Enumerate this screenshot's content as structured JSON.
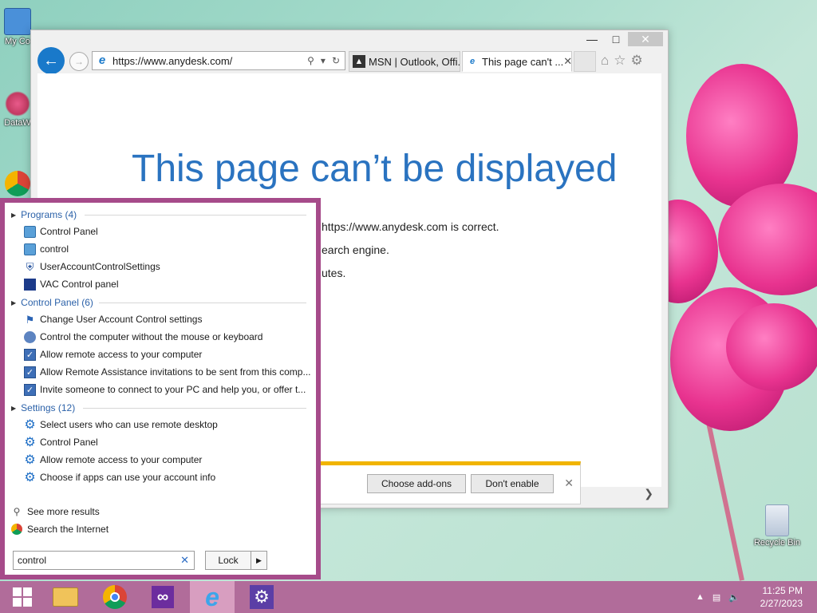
{
  "desktop": {
    "icons": [
      {
        "label": "My Co"
      },
      {
        "label": "DataW"
      },
      {
        "label": ""
      },
      {
        "label": "Recycle Bin"
      }
    ]
  },
  "browser": {
    "address": "https://www.anydesk.com/",
    "tabs": [
      {
        "label": "MSN | Outlook, Offi..."
      },
      {
        "label": "This page can't ..."
      }
    ],
    "error": {
      "title": "This page can’t be displayed",
      "lines": [
        "https://www.anydesk.com is correct.",
        "earch engine.",
        "utes."
      ]
    },
    "notification": {
      "choose_label": "Choose add-ons",
      "dont_label": "Don't enable"
    }
  },
  "search": {
    "sections": [
      {
        "title": "Programs (4)",
        "items": [
          {
            "label": "Control Panel",
            "icon": "control-panel-icon"
          },
          {
            "label": "control",
            "icon": "control-panel-icon"
          },
          {
            "label": "UserAccountControlSettings",
            "icon": "shield-icon"
          },
          {
            "label": "VAC Control panel",
            "icon": "vac-icon"
          }
        ]
      },
      {
        "title": "Control Panel (6)",
        "items": [
          {
            "label": "Change User Account Control settings",
            "icon": "flag-icon"
          },
          {
            "label": "Control the computer without the mouse or keyboard",
            "icon": "ease-of-access-icon"
          },
          {
            "label": "Allow remote access to your computer",
            "icon": "monitor-check-icon"
          },
          {
            "label": "Allow Remote Assistance invitations to be sent from this comp...",
            "icon": "monitor-check-icon"
          },
          {
            "label": "Invite someone to connect to your PC and help you, or offer t...",
            "icon": "monitor-check-icon"
          }
        ]
      },
      {
        "title": "Settings (12)",
        "items": [
          {
            "label": "Select users who can use remote desktop",
            "icon": "gear-icon"
          },
          {
            "label": "Control Panel",
            "icon": "gear-icon"
          },
          {
            "label": "Allow remote access to your computer",
            "icon": "gear-icon"
          },
          {
            "label": "Choose if apps can use your account info",
            "icon": "gear-icon"
          }
        ]
      }
    ],
    "see_more": "See more results",
    "search_internet": "Search the Internet",
    "query": "control",
    "power_label": "Lock"
  },
  "taskbar": {
    "time": "11:25 PM",
    "date": "2/27/2023"
  },
  "colors": {
    "accent": "#1979ca",
    "start_panel_border": "#a64b8a",
    "taskbar": "#b16c9a",
    "error_title": "#2a73c0",
    "notification_bar": "#f1b400"
  }
}
